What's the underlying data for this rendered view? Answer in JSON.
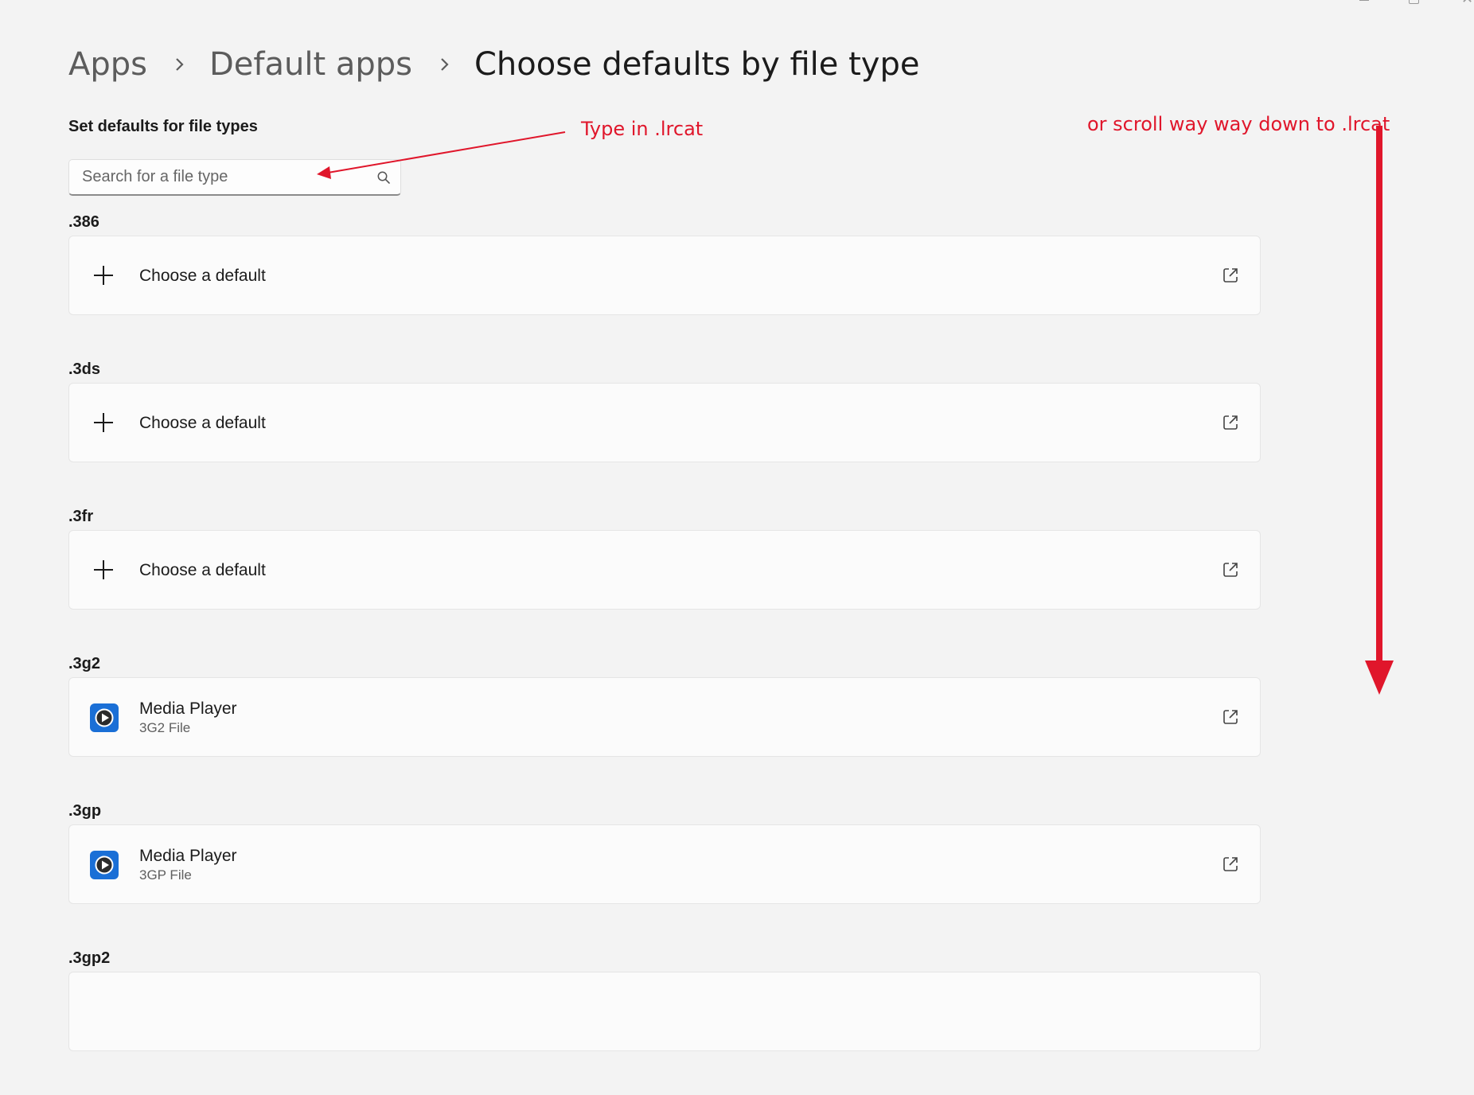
{
  "breadcrumb": {
    "items": [
      "Apps",
      "Default apps"
    ],
    "current": "Choose defaults by file type"
  },
  "section_title": "Set defaults for file types",
  "search": {
    "placeholder": "Search for a file type",
    "value": ""
  },
  "file_types": [
    {
      "ext": ".386",
      "app": "Choose a default",
      "subtitle": "",
      "kind": "none"
    },
    {
      "ext": ".3ds",
      "app": "Choose a default",
      "subtitle": "",
      "kind": "none"
    },
    {
      "ext": ".3fr",
      "app": "Choose a default",
      "subtitle": "",
      "kind": "none"
    },
    {
      "ext": ".3g2",
      "app": "Media Player",
      "subtitle": "3G2 File",
      "kind": "media"
    },
    {
      "ext": ".3gp",
      "app": "Media Player",
      "subtitle": "3GP File",
      "kind": "media"
    },
    {
      "ext": ".3gp2",
      "app": "",
      "subtitle": "",
      "kind": "partial"
    }
  ],
  "annotations": {
    "type_hint": "Type in .lrcat",
    "scroll_hint": "or scroll way way down to .lrcat",
    "color": "#e0162b"
  },
  "colors": {
    "background": "#f3f3f3",
    "card": "#fbfbfb",
    "media_player_icon": "#1a6fd6"
  }
}
